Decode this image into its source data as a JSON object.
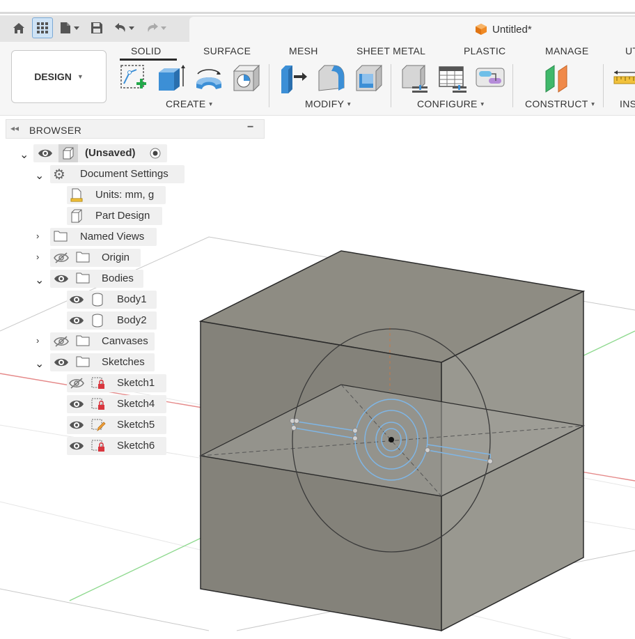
{
  "window": {
    "doc_title": "Untitled*"
  },
  "quick_access": {
    "home_icon": "home-icon",
    "grid_icon": "data-panel-icon",
    "file_icon": "file-icon",
    "save_icon": "save-icon",
    "undo_icon": "undo-icon",
    "redo_icon": "redo-icon"
  },
  "ribbon": {
    "workspace_button": "DESIGN",
    "tabs": [
      "SOLID",
      "SURFACE",
      "MESH",
      "SHEET METAL",
      "PLASTIC",
      "MANAGE",
      "UT"
    ],
    "active_tab": "SOLID",
    "groups": [
      "CREATE",
      "MODIFY",
      "CONFIGURE",
      "CONSTRUCT",
      "INS"
    ]
  },
  "browser": {
    "title": "BROWSER",
    "items": [
      {
        "label": "(Unsaved)"
      },
      {
        "label": "Document Settings"
      },
      {
        "label": "Units: mm, g"
      },
      {
        "label": "Part Design"
      },
      {
        "label": "Named Views"
      },
      {
        "label": "Origin"
      },
      {
        "label": "Bodies"
      },
      {
        "label": "Body1"
      },
      {
        "label": "Body2"
      },
      {
        "label": "Canvases"
      },
      {
        "label": "Sketches"
      },
      {
        "label": "Sketch1"
      },
      {
        "label": "Sketch4"
      },
      {
        "label": "Sketch5"
      },
      {
        "label": "Sketch6"
      }
    ]
  },
  "colors": {
    "accent_blue": "#3c8fd6",
    "sketch_blue": "#7fb6e6",
    "body_gray": "#8e8c83",
    "axis_red": "#e58a8a",
    "axis_green": "#8fd98f",
    "lock_red": "#d9363e"
  }
}
